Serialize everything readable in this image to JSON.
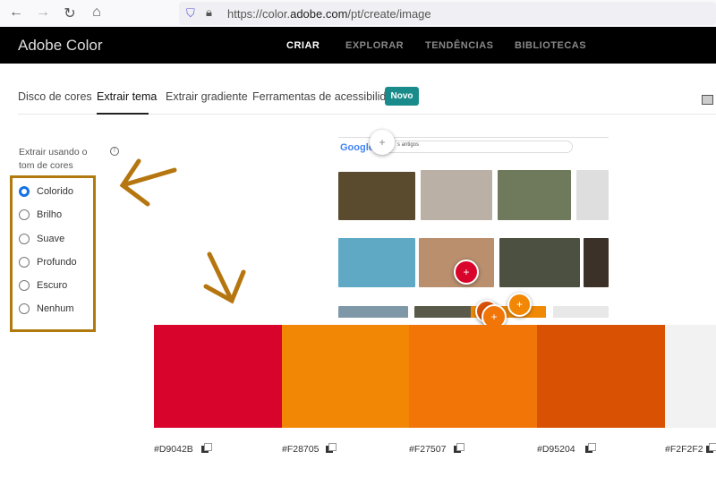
{
  "browser": {
    "url_prefix": "https://color.",
    "url_domain": "adobe.com",
    "url_path": "/pt/create/image"
  },
  "header": {
    "brand": "Adobe Color",
    "nav": [
      {
        "label": "CRIAR",
        "active": true
      },
      {
        "label": "EXPLORAR"
      },
      {
        "label": "TENDÊNCIAS"
      },
      {
        "label": "BIBLIOTECAS"
      }
    ]
  },
  "tabs": [
    {
      "label": "Disco de cores"
    },
    {
      "label": "Extrair tema",
      "active": true
    },
    {
      "label": "Extrair gradiente"
    },
    {
      "label": "Ferramentas de acessibilidade"
    }
  ],
  "badge": "Novo",
  "panel": {
    "label": "Extrair usando o tom de cores",
    "options": [
      "Colorido",
      "Brilho",
      "Suave",
      "Profundo",
      "Escuro",
      "Nenhum"
    ],
    "selected": "Colorido"
  },
  "preview": {
    "search_brand": "Google",
    "search_text": "s antigos"
  },
  "swatches": [
    {
      "hex": "#D9042B"
    },
    {
      "hex": "#F28705"
    },
    {
      "hex": "#F27507"
    },
    {
      "hex": "#D95204"
    },
    {
      "hex": "#F2F2F2"
    }
  ],
  "colors": {
    "accent": "#1473e6",
    "badge": "#1a8b8b",
    "annotation": "#b07a0f"
  }
}
